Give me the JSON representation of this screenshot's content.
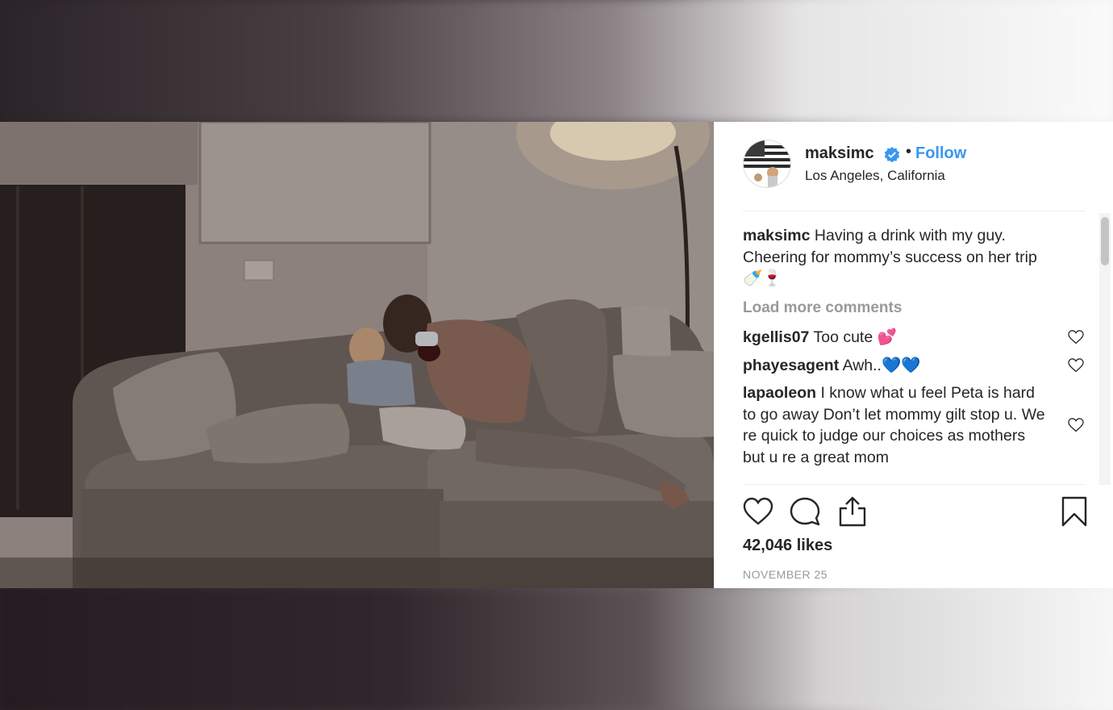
{
  "post": {
    "username": "maksimc",
    "follow_label": "Follow",
    "separator": "•",
    "location": "Los Angeles, California",
    "caption_user": "maksimc",
    "caption_text": "Having a drink with my guy. Cheering for mommy’s success on her trip🍼🍷",
    "load_more": "Load more comments",
    "comments": [
      {
        "user": "kgellis07",
        "text": "Too cute 💕"
      },
      {
        "user": "phayesagent",
        "text": "Awh..💙💙"
      },
      {
        "user": "lapaoleon",
        "text": "I know what u feel Peta is hard to go away Don’t let mommy gilt stop u. We re quick to judge our choices as mothers but u re a great mom"
      }
    ],
    "likes": "42,046 likes",
    "date": "NOVEMBER 25"
  },
  "icons": [
    "verified-badge-icon",
    "heart-icon",
    "comment-icon",
    "share-icon",
    "bookmark-icon"
  ],
  "colors": {
    "link_blue": "#3897f0",
    "text": "#262626",
    "muted": "#999999"
  }
}
